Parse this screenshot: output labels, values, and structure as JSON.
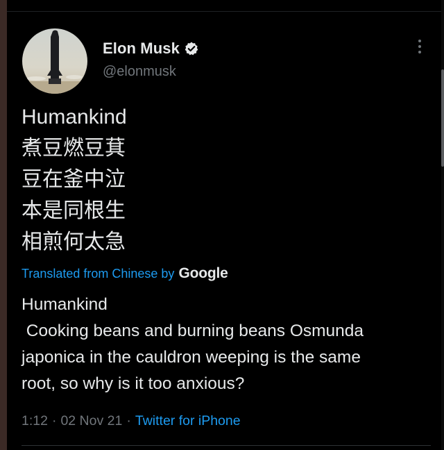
{
  "author": {
    "display_name": "Elon Musk",
    "handle": "@elonmusk",
    "verified": true
  },
  "icons": {
    "verified": "verified-badge-icon",
    "more": "more-options-icon"
  },
  "tweet": {
    "lines": [
      "Humankind",
      "煮豆燃豆萁",
      "豆在釜中泣",
      "本是同根生",
      "相煎何太急"
    ]
  },
  "translation": {
    "label": "Translated from Chinese by",
    "provider": "Google",
    "lines": [
      "Humankind",
      " Cooking beans and burning beans Osmunda",
      "japonica in the cauldron weeping is the same",
      "root, so why is it too anxious?"
    ]
  },
  "meta": {
    "time": "1:12",
    "date": "02 Nov 21",
    "separator": "·",
    "source": "Twitter for iPhone"
  },
  "colors": {
    "background": "#000000",
    "text": "#e7e9ea",
    "secondary": "#71767b",
    "accent": "#1d9bf0"
  }
}
